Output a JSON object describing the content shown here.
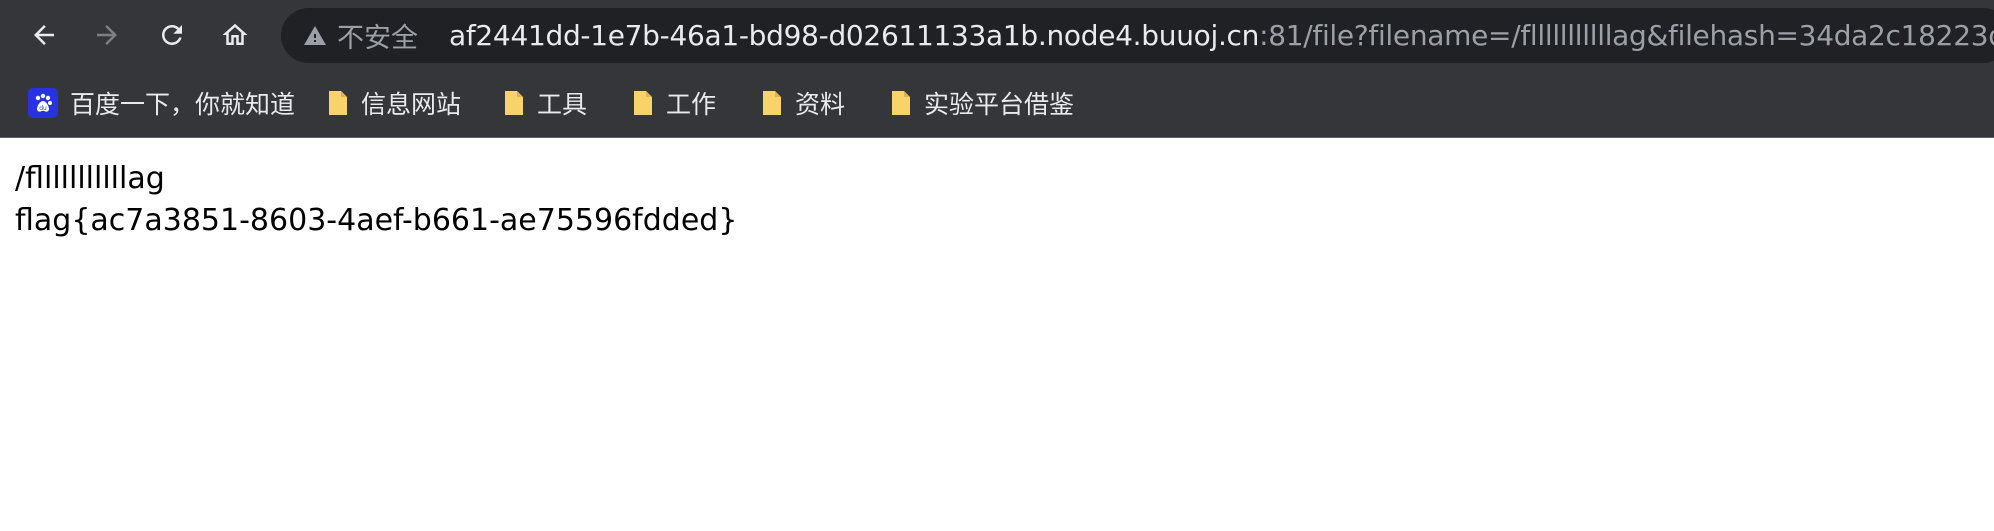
{
  "toolbar": {
    "security_label": "不安全",
    "url_host": "af2441dd-1e7b-46a1-bd98-d02611133a1b.node4.buuoj.cn",
    "url_rest": ":81/file?filename=/flllllllllllag&filehash=34da2c18223d...",
    "icons": [
      "back-arrow-icon",
      "forward-arrow-icon",
      "reload-icon",
      "home-icon",
      "warning-triangle-icon"
    ]
  },
  "bookmarks": {
    "items": [
      {
        "label": "百度一下，你就知道",
        "icon": "baidu-favicon-icon"
      },
      {
        "label": "信息网站",
        "icon": "folder-icon"
      },
      {
        "label": "工具",
        "icon": "folder-icon"
      },
      {
        "label": "工作",
        "icon": "folder-icon"
      },
      {
        "label": "资料",
        "icon": "folder-icon"
      },
      {
        "label": "实验平台借鉴",
        "icon": "folder-icon"
      }
    ]
  },
  "page": {
    "lines": [
      "/flllllllllllag",
      "flag{ac7a3851-8603-4aef-b661-ae75596fdded}"
    ]
  },
  "colors": {
    "chrome_bg": "#35363a",
    "omnibox_bg": "#202124",
    "text_light": "#e8eaed",
    "text_muted": "#9aa0a6",
    "folder": "#f8d36a"
  }
}
